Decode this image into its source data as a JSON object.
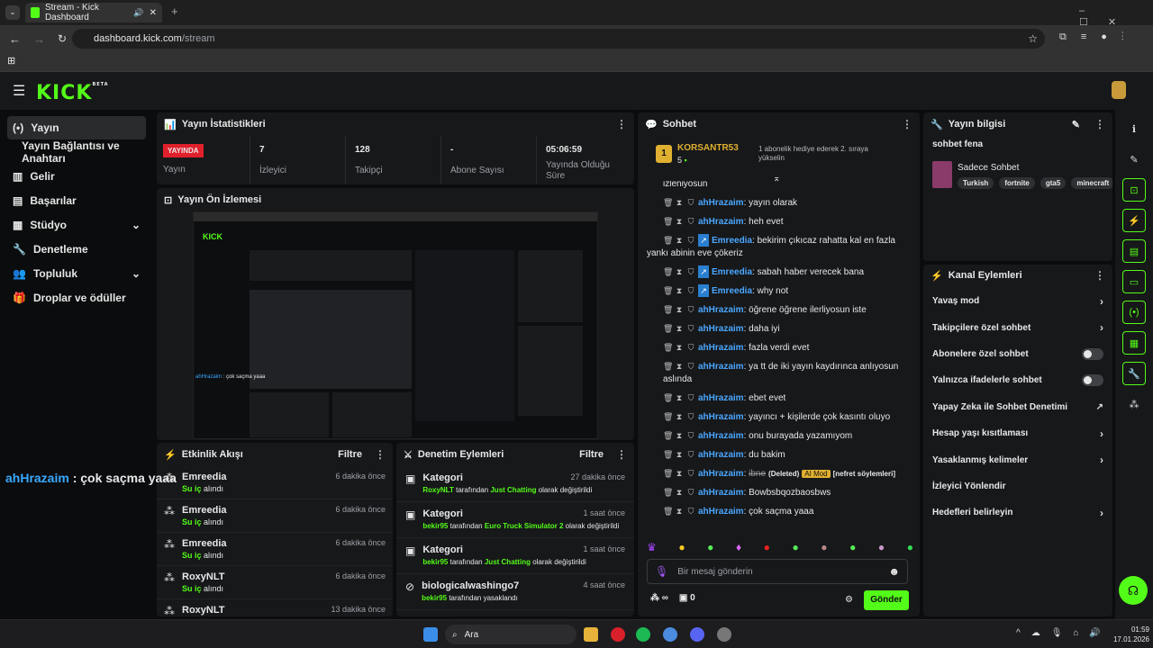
{
  "browser": {
    "tab_title": "Stream - Kick Dashboard",
    "url_host": "dashboard.kick.com",
    "url_path": "/stream"
  },
  "logo": "KICK",
  "logo_badge": "BETA",
  "sidebar": {
    "items": [
      {
        "label": "Yayın",
        "icon": "broadcast-icon",
        "active": true
      },
      {
        "label": "Yayın Bağlantısı ve Anahtarı",
        "icon": ""
      },
      {
        "label": "Gelir",
        "icon": "chart-icon"
      },
      {
        "label": "Başarılar",
        "icon": "trophy-icon"
      },
      {
        "label": "Stüdyo",
        "icon": "grid-icon",
        "chevron": true
      },
      {
        "label": "Denetleme",
        "icon": "wrench-icon"
      },
      {
        "label": "Topluluk",
        "icon": "people-icon",
        "chevron": true
      },
      {
        "label": "Droplar ve ödüller",
        "icon": "gift-icon"
      }
    ]
  },
  "overlay_text": {
    "user": "ahHrazaim",
    "message": " : çok saçma yaaa"
  },
  "stats": {
    "title": "Yayın İstatistikleri",
    "items": [
      {
        "value": "YAYINDA",
        "label": "Yayın",
        "badge": true
      },
      {
        "value": "7",
        "label": "İzleyici"
      },
      {
        "value": "128",
        "label": "Takipçi"
      },
      {
        "value": "-",
        "label": "Abone Sayısı"
      },
      {
        "value": "05:06:59",
        "label": "Yayında Olduğu Süre"
      }
    ]
  },
  "preview": {
    "title": "Yayın Ön İzlemesi"
  },
  "activity": {
    "title": "Etkinlik Akışı",
    "filter": "Filtre",
    "rows": [
      {
        "name": "Emreedia",
        "sub_green": "Su iç",
        "sub": " alındı",
        "time": "6 dakika önce"
      },
      {
        "name": "Emreedia",
        "sub_green": "Su iç",
        "sub": " alındı",
        "time": "6 dakika önce"
      },
      {
        "name": "Emreedia",
        "sub_green": "Su iç",
        "sub": " alındı",
        "time": "6 dakika önce"
      },
      {
        "name": "RoxyNLT",
        "sub_green": "Su iç",
        "sub": " alındı",
        "time": "6 dakika önce"
      },
      {
        "name": "RoxyNLT",
        "sub_green": "",
        "sub": "",
        "time": "13 dakika önce"
      }
    ]
  },
  "moderation": {
    "title": "Denetim Eylemleri",
    "filter": "Filtre",
    "rows": [
      {
        "title": "Kategori",
        "time": "27 dakika önce",
        "u": "RoxyNLT",
        "mid": " tarafından ",
        "cat": "Just Chatting",
        "end": " olarak değiştirildi"
      },
      {
        "title": "Kategori",
        "time": "1 saat önce",
        "u": "bekir95",
        "mid": " tarafından ",
        "cat": "Euro Truck Simulator 2",
        "end": " olarak değiştirildi"
      },
      {
        "title": "Kategori",
        "time": "1 saat önce",
        "u": "bekir95",
        "mid": " tarafından ",
        "cat": "Just Chatting",
        "end": " olarak değiştirildi"
      },
      {
        "title": "biologicalwashingo7",
        "time": "4 saat önce",
        "u": "bekir95",
        "mid": " tarafından yasaklandı",
        "cat": "",
        "end": ""
      }
    ]
  },
  "chat": {
    "title": "Sohbet",
    "pinned_user": "KORSANTR53",
    "pinned_rank": "1",
    "pinned_count": "5",
    "pinned_text": "1 abonelik hediye ederek 2. sıraya yükselin",
    "cut_line": "izleniyosun",
    "messages": [
      {
        "user": "ahHrazaim",
        "text": "yayın olarak"
      },
      {
        "user": "ahHrazaim",
        "text": "heh evet"
      },
      {
        "user": "Emreedia",
        "text": "bekirim çıkıcaz rahatta kal en fazla yankı abinin eve çökeriz",
        "two": true
      },
      {
        "user": "Emreedia",
        "text": "sabah haber verecek bana"
      },
      {
        "user": "Emreedia",
        "text": "why not"
      },
      {
        "user": "ahHrazaim",
        "text": "öğrene öğrene ilerliyosun iste"
      },
      {
        "user": "ahHrazaim",
        "text": "daha iyi"
      },
      {
        "user": "ahHrazaim",
        "text": "fazla verdi evet"
      },
      {
        "user": "ahHrazaim",
        "text": "ya tt de iki yayın kaydırınca anlıyosun aslında"
      },
      {
        "user": "ahHrazaim",
        "text": "ebet evet"
      },
      {
        "user": "ahHrazaim",
        "text": "yayıncı + kişilerde çok kasıntı oluyo"
      },
      {
        "user": "ahHrazaim",
        "text": "onu burayada yazamıyom"
      },
      {
        "user": "ahHrazaim",
        "text": "du bakim"
      },
      {
        "user": "ahHrazaim",
        "text": "ibne",
        "deleted": "(Deleted)",
        "ai": "AI Mod",
        "reason": "[nefret söylemleri]"
      },
      {
        "user": "ahHrazaim",
        "text": "Bowbsbqozbaosbws"
      },
      {
        "user": "ahHrazaim",
        "text": "çok saçma yaaa"
      }
    ],
    "placeholder": "Bir mesaj gönderin",
    "send": "Gönder",
    "gift_count": "0",
    "infinity": "∞"
  },
  "stream_info": {
    "title": "Yayın bilgisi",
    "stream_title": "sohbet fena",
    "category": "Sadece Sohbet",
    "tags": [
      "Turkish",
      "fortnite",
      "gta5",
      "minecraft"
    ]
  },
  "channel_actions": {
    "title": "Kanal Eylemleri",
    "rows": [
      {
        "label": "Yavaş mod",
        "kind": "chev"
      },
      {
        "label": "Takipçilere özel sohbet",
        "kind": "chev"
      },
      {
        "label": "Abonelere özel sohbet",
        "kind": "toggle"
      },
      {
        "label": "Yalnızca ifadelerle sohbet",
        "kind": "toggle"
      },
      {
        "label": "Yapay Zeka ile Sohbet Denetimi",
        "kind": "ext"
      },
      {
        "label": "Hesap yaşı kısıtlaması",
        "kind": "chev"
      },
      {
        "label": "Yasaklanmış kelimeler",
        "kind": "chev"
      },
      {
        "label": "İzleyici Yönlendir",
        "kind": "none"
      },
      {
        "label": "Hedefleri belirleyin",
        "kind": "chev"
      }
    ]
  },
  "taskbar": {
    "search": "Ara",
    "time": "01:59",
    "date": "17.01.2026"
  },
  "colors": {
    "accent": "#53fc18",
    "live": "#e0202b",
    "panel": "#17181a"
  }
}
